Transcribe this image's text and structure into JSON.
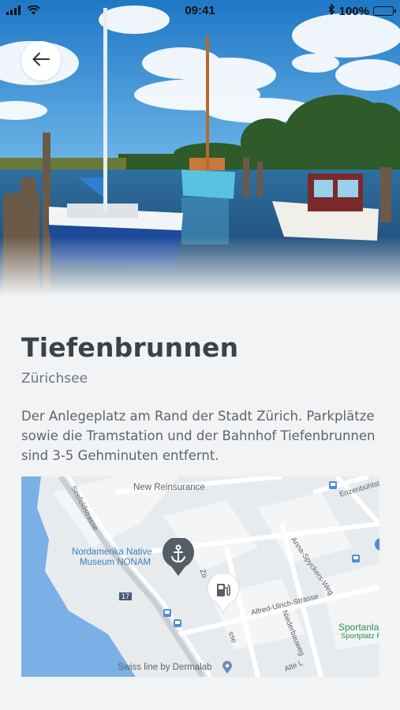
{
  "status_bar": {
    "time": "09:41",
    "battery": "100%"
  },
  "header": {
    "back_icon": "arrow-left-icon"
  },
  "place": {
    "title": "Tiefenbrunnen",
    "subtitle": "Zürichsee",
    "description": "Der Anlegeplatz am Rand der Stadt Zürich. Parkplätze sowie die Tramstation und der Bahnhof Tiefenbrunnen sind 3-5 Gehminuten entfernt."
  },
  "map": {
    "labels": {
      "new_reinsurance": "New Reinsurance",
      "museum_line1": "Nordamerika Native",
      "museum_line2": "Museum NONAM",
      "seefeld": "Seefeldstrasse",
      "anna": "Anna-Spyckers-Weg",
      "alfred": "Alfred-Ulrich-Strasse",
      "niederbau": "Niederbauweg",
      "enzenbuehl": "Enzenbühlstr",
      "sportanlage": "Sportanla",
      "sportplatz": "Sportplatz F",
      "swiss_line": "Swiss line by Dermalab",
      "alte": "Alte L",
      "zo": "Zo",
      "route_17": "17",
      "se": "sse"
    },
    "pins": {
      "anchor": "anchor-icon",
      "fuel": "fuel-pump-icon"
    }
  }
}
